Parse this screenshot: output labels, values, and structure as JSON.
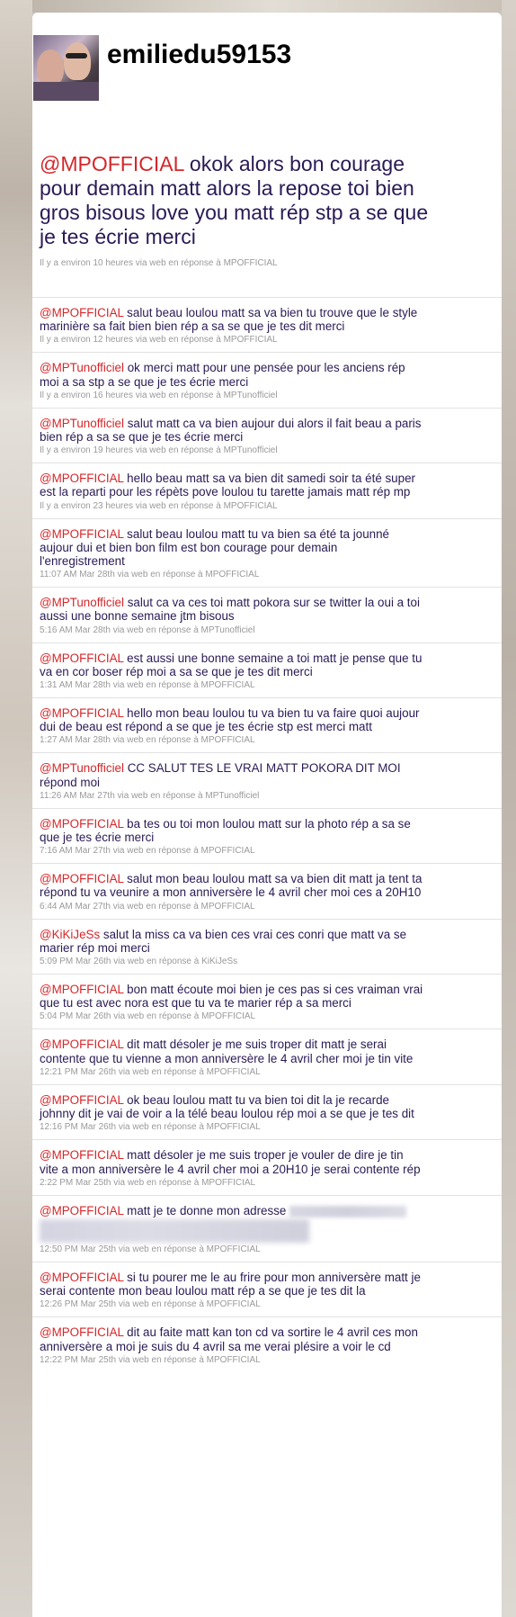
{
  "profile": {
    "username": "emiliedu59153"
  },
  "main_tweet": {
    "mention": "@MPOFFICIAL",
    "text": " okok alors bon courage pour demain matt alors la repose toi bien gros bisous love you matt rép stp a se que je tes écrie merci",
    "meta": "Il y a environ 10 heures via web en réponse à MPOFFICIAL"
  },
  "tweets": [
    {
      "mention": "@MPOFFICIAL",
      "text": " salut beau loulou matt sa va bien tu trouve que le style marinière sa fait bien bien rép a sa se que je tes dit merci",
      "meta": "Il y a environ 12 heures via web en réponse à MPOFFICIAL"
    },
    {
      "mention": "@MPTunofficiel",
      "text": " ok merci matt pour une pensée pour les anciens rép moi a sa stp a se que je tes écrie merci",
      "meta": "Il y a environ 16 heures via web en réponse à MPTunofficiel"
    },
    {
      "mention": "@MPTunofficiel",
      "text": " salut matt ca va bien aujour dui alors il fait beau a paris bien rép a sa se que je tes écrie merci",
      "meta": "Il y a environ 19 heures via web en réponse à MPTunofficiel"
    },
    {
      "mention": "@MPOFFICIAL",
      "text": " hello beau matt sa va bien dit samedi soir ta été super est la reparti pour les répèts pove loulou tu tarette jamais matt rép mp",
      "meta": "Il y a environ 23 heures via web en réponse à MPOFFICIAL"
    },
    {
      "mention": "@MPOFFICIAL",
      "text": " salut beau loulou matt tu va bien sa été ta jounné aujour dui et bien bon film est bon courage pour demain l'enregistrement",
      "meta": "11:07 AM Mar 28th via web en réponse à MPOFFICIAL"
    },
    {
      "mention": "@MPTunofficiel",
      "text": " salut ca va ces toi matt pokora sur se twitter la oui a toi aussi une bonne semaine jtm bisous",
      "meta": "5:16 AM Mar 28th via web en réponse à MPTunofficiel"
    },
    {
      "mention": "@MPOFFICIAL",
      "text": " est aussi une bonne semaine a toi matt je pense que tu va en cor boser rép moi a sa se que je tes dit merci",
      "meta": "1:31 AM Mar 28th via web en réponse à MPOFFICIAL"
    },
    {
      "mention": "@MPOFFICIAL",
      "text": " hello mon beau loulou tu va bien tu va faire quoi aujour dui de beau est répond a se que je tes écrie stp est merci matt",
      "meta": "1:27 AM Mar 28th via web en réponse à MPOFFICIAL"
    },
    {
      "mention": "@MPTunofficiel",
      "text": " CC SALUT TES LE VRAI MATT POKORA DIT MOI répond moi",
      "meta": "11:26 AM Mar 27th via web en réponse à MPTunofficiel"
    },
    {
      "mention": "@MPOFFICIAL",
      "text": " ba tes ou toi mon loulou matt sur la photo rép a sa se que je tes écrie merci",
      "meta": "7:16 AM Mar 27th via web en réponse à MPOFFICIAL"
    },
    {
      "mention": "@MPOFFICIAL",
      "text": " salut mon beau loulou matt sa va bien dit matt ja tent ta répond tu va veunire a mon anniversère le 4 avril cher moi ces a 20H10",
      "meta": "6:44 AM Mar 27th via web en réponse à MPOFFICIAL"
    },
    {
      "mention": "@KiKiJeSs",
      "text": " salut la miss ca va bien ces vrai ces conri que matt va se marier rép moi merci",
      "meta": "5:09 PM Mar 26th via web en réponse à KiKiJeSs"
    },
    {
      "mention": "@MPOFFICIAL",
      "text": " bon matt écoute moi bien je ces pas si ces vraiman vrai que tu est avec nora est que tu va te marier rép a sa merci",
      "meta": "5:04 PM Mar 26th via web en réponse à MPOFFICIAL"
    },
    {
      "mention": "@MPOFFICIAL",
      "text": " dit matt désoler je me suis troper dit matt je serai contente que tu vienne a mon anniversère le 4 avril cher moi je tin vite",
      "meta": "12:21 PM Mar 26th via web en réponse à MPOFFICIAL"
    },
    {
      "mention": "@MPOFFICIAL",
      "text": " ok beau loulou matt tu va bien toi dit la je recarde johnny dit je vai de voir a la télé beau loulou rép moi a se que je tes dit",
      "meta": "12:16 PM Mar 26th via web en réponse à MPOFFICIAL"
    },
    {
      "mention": "@MPOFFICIAL",
      "text": " matt désoler je me suis troper je vouler de dire je tin vite a mon anniversère le 4 avril cher moi a 20H10 je serai contente rép",
      "meta": "2:22 PM Mar 25th via web en réponse à MPOFFICIAL"
    },
    {
      "mention": "@MPOFFICIAL",
      "text": " matt je te donne mon adresse ",
      "meta": "12:50 PM Mar 25th via web en réponse à MPOFFICIAL",
      "redacted": true
    },
    {
      "mention": "@MPOFFICIAL",
      "text": " si tu pourer me le au frire pour mon anniversère matt je serai contente mon beau loulou matt rép a se que je tes dit la",
      "meta": "12:26 PM Mar 25th via web en réponse à MPOFFICIAL"
    },
    {
      "mention": "@MPOFFICIAL",
      "text": " dit au faite matt kan ton cd va sortire le 4 avril ces mon anniversère a moi je suis du 4 avril sa me verai plésire a voir le cd",
      "meta": "12:22 PM Mar 25th via web en réponse à MPOFFICIAL"
    }
  ]
}
